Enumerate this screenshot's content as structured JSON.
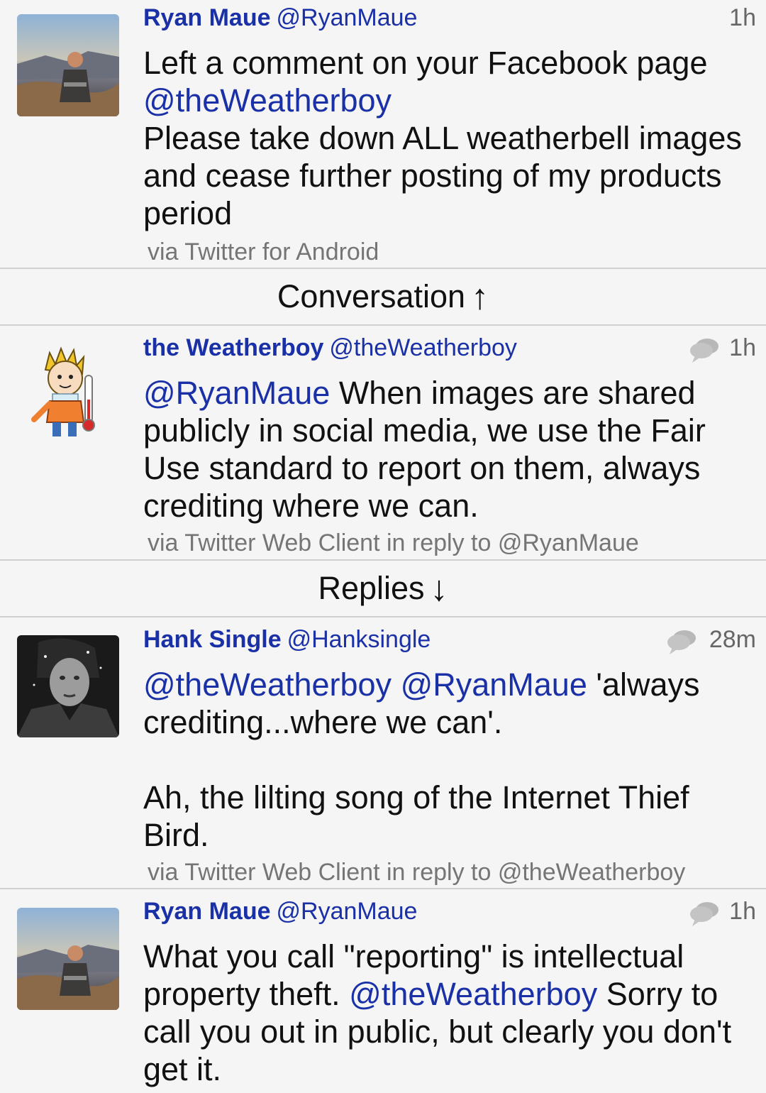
{
  "tweets": [
    {
      "name": "Ryan Maue",
      "handle": "@RyanMaue",
      "time": "1h",
      "body": [
        {
          "text": "Left a comment on your Facebook page "
        },
        {
          "text": "@theWeatherboy",
          "mention": true
        },
        {
          "text": " Please take down ALL weatherbell images and cease further posting of my products period"
        }
      ],
      "via": "via Twitter for Android"
    },
    {
      "name": "the Weatherboy",
      "handle": "@theWeatherboy",
      "time": "1h",
      "body": [
        {
          "text": "@RyanMaue",
          "mention": true
        },
        {
          "text": " When images are shared publicly in social media, we use the Fair Use standard to report on them, always crediting where we can."
        }
      ],
      "via": "via Twitter Web Client in reply to @RyanMaue"
    },
    {
      "name": "Hank Single",
      "handle": "@Hanksingle",
      "time": "28m",
      "body": [
        {
          "text": "@theWeatherboy",
          "mention": true
        },
        {
          "text": " "
        },
        {
          "text": "@RyanMaue",
          "mention": true
        },
        {
          "text": " 'always crediting...where we can'."
        },
        {
          "text": "\n\nAh, the lilting song of the Internet Thief Bird."
        }
      ],
      "via": "via Twitter Web Client in reply to @theWeatherboy"
    },
    {
      "name": "Ryan Maue",
      "handle": "@RyanMaue",
      "time": "1h",
      "body": [
        {
          "text": "What you call \"reporting\" is intellectual property theft. "
        },
        {
          "text": "@theWeatherboy",
          "mention": true
        },
        {
          "text": " Sorry to call you out in public, but clearly you don't get it."
        }
      ],
      "via": ""
    }
  ],
  "sections": {
    "conversation": {
      "label": "Conversation",
      "arrow": "↑"
    },
    "replies": {
      "label": "Replies",
      "arrow": "↓"
    }
  },
  "colors": {
    "link": "#1a30a6",
    "meta": "#757575",
    "background": "#f5f5f5",
    "divider": "#cfcfcf"
  },
  "icons": {
    "reply_bubble": "conversation-bubble-icon"
  }
}
